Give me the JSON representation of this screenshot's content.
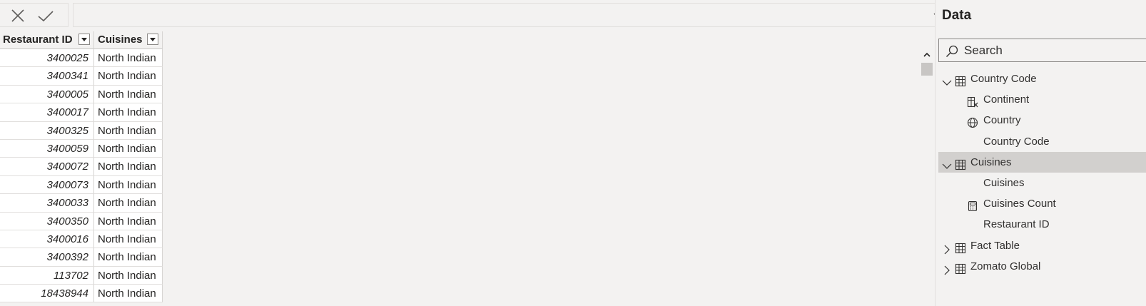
{
  "table": {
    "columns": [
      "Restaurant ID",
      "Cuisines"
    ],
    "rows": [
      [
        "3400025",
        "North Indian"
      ],
      [
        "3400341",
        "North Indian"
      ],
      [
        "3400005",
        "North Indian"
      ],
      [
        "3400017",
        "North Indian"
      ],
      [
        "3400325",
        "North Indian"
      ],
      [
        "3400059",
        "North Indian"
      ],
      [
        "3400072",
        "North Indian"
      ],
      [
        "3400073",
        "North Indian"
      ],
      [
        "3400033",
        "North Indian"
      ],
      [
        "3400350",
        "North Indian"
      ],
      [
        "3400016",
        "North Indian"
      ],
      [
        "3400392",
        "North Indian"
      ],
      [
        "113702",
        "North Indian"
      ],
      [
        "18438944",
        "North Indian"
      ]
    ]
  },
  "data_pane": {
    "title": "Data",
    "search_placeholder": "Search",
    "tree": [
      {
        "label": "Country Code",
        "icon": "table-icon",
        "level": 0,
        "expanded": true,
        "selected": false
      },
      {
        "label": "Continent",
        "icon": "calculated-column-icon",
        "level": 1
      },
      {
        "label": "Country",
        "icon": "globe-icon",
        "level": 1
      },
      {
        "label": "Country Code",
        "icon": "",
        "level": 1
      },
      {
        "label": "Cuisines",
        "icon": "table-icon",
        "level": 0,
        "expanded": true,
        "selected": true
      },
      {
        "label": "Cuisines",
        "icon": "",
        "level": 1
      },
      {
        "label": "Cuisines Count",
        "icon": "calculator-icon",
        "level": 1
      },
      {
        "label": "Restaurant ID",
        "icon": "",
        "level": 1
      },
      {
        "label": "Fact Table",
        "icon": "table-icon",
        "level": 0,
        "expanded": false,
        "selected": false
      },
      {
        "label": "Zomato Global",
        "icon": "table-icon",
        "level": 0,
        "expanded": false,
        "selected": false
      }
    ]
  },
  "colors": {
    "background": "#f3f2f1",
    "selected_row": "#d2d0ce",
    "scroll_thumb": "#c8c6c4",
    "text": "#252423"
  }
}
